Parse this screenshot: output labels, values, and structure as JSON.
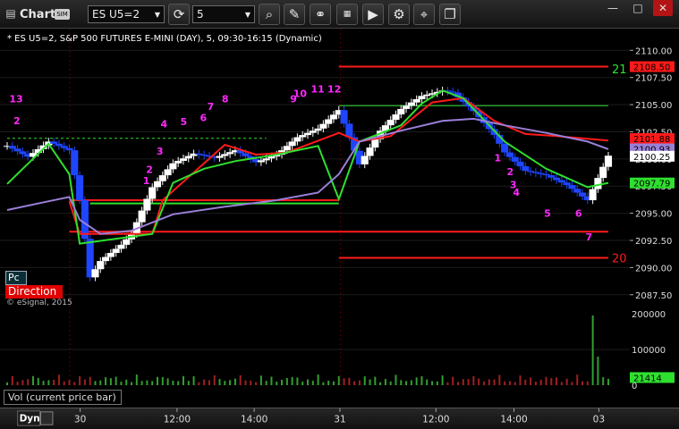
{
  "titlebar": {
    "chart_label": "Chart",
    "sim_label": "SIM",
    "symbol_value": "ES U5=2",
    "interval_value": "5",
    "icons": [
      "chart-icon",
      "refresh-icon",
      "search-icon",
      "draw-icon",
      "news-icon",
      "play-icon",
      "settings-icon",
      "pin-icon",
      "link-icon",
      "minimize-icon",
      "maximize-icon",
      "close-icon"
    ]
  },
  "header": {
    "description": "* ES U5=2, S&P 500 FUTURES E-MINI (DAY), 5, 09:30-16:15 (Dynamic)"
  },
  "badges": {
    "pc": "Pc",
    "direction": "Direction",
    "copyright": "© eSignal, 2015"
  },
  "volume_panel": {
    "label": "Vol (current price bar)"
  },
  "bottom_bar": {
    "label": "Dyn"
  },
  "colors": {
    "background": "#000000",
    "up": "#ffffff",
    "down": "#1f46ff",
    "red_level": "#ff1a1a",
    "green_level": "#2fe02f",
    "vwap": "#9a7fd8",
    "count": "#ff28ff"
  },
  "chart_data": [
    {
      "type": "line",
      "title": "",
      "ylim": [
        2086,
        2112
      ],
      "x_ticks": [
        "30",
        "12:00",
        "14:00",
        "31",
        "12:00",
        "14:00",
        "03"
      ],
      "y_ticks": [
        "2110.00",
        "2107.50",
        "2105.00",
        "2102.50",
        "2100.00",
        "2097.50",
        "2095.00",
        "2092.50",
        "2090.00",
        "2087.50"
      ],
      "price_tags": [
        {
          "value": "2108.50",
          "color": "#ff1a1a"
        },
        {
          "value": "2101.88",
          "color": "#ff1a1a"
        },
        {
          "value": "2100.93",
          "color": "#9a7fd8"
        },
        {
          "value": "2100.25",
          "color": "#ffffff"
        },
        {
          "value": "2097.79",
          "color": "#2fe02f"
        }
      ],
      "level_labels": [
        {
          "text": "21",
          "value": 2108.3,
          "color": "#2fe02f"
        },
        {
          "text": "20",
          "value": 2090.9,
          "color": "#ff1a1a"
        }
      ],
      "counts": [
        {
          "text": "13",
          "x": 0.2,
          "y": 2105.2
        },
        {
          "text": "2",
          "x": 0.6,
          "y": 2103.2
        },
        {
          "text": "1",
          "x": 13.1,
          "y": 2097.7
        },
        {
          "text": "2",
          "x": 13.4,
          "y": 2098.7
        },
        {
          "text": "3",
          "x": 14.4,
          "y": 2100.4
        },
        {
          "text": "4",
          "x": 14.8,
          "y": 2102.9
        },
        {
          "text": "5",
          "x": 16.7,
          "y": 2103.1
        },
        {
          "text": "6",
          "x": 18.6,
          "y": 2103.5
        },
        {
          "text": "7",
          "x": 19.3,
          "y": 2104.5
        },
        {
          "text": "8",
          "x": 20.7,
          "y": 2105.2
        },
        {
          "text": "9",
          "x": 27.3,
          "y": 2105.2
        },
        {
          "text": "10",
          "x": 27.6,
          "y": 2105.7
        },
        {
          "text": "11",
          "x": 29.3,
          "y": 2106.1
        },
        {
          "text": "12",
          "x": 30.9,
          "y": 2106.1
        },
        {
          "text": "1",
          "x": 47.0,
          "y": 2099.8
        },
        {
          "text": "2",
          "x": 48.2,
          "y": 2098.5
        },
        {
          "text": "3",
          "x": 48.5,
          "y": 2097.3
        },
        {
          "text": "4",
          "x": 48.8,
          "y": 2096.6
        },
        {
          "text": "5",
          "x": 51.8,
          "y": 2094.7
        },
        {
          "text": "6",
          "x": 54.8,
          "y": 2094.7
        },
        {
          "text": "7",
          "x": 55.8,
          "y": 2092.5
        }
      ],
      "series": [
        {
          "points": [
            [
              0,
              2101.2
            ],
            [
              2,
              2100.2
            ],
            [
              4,
              2101.6
            ],
            [
              6,
              2100.8
            ],
            [
              7,
              2096.2
            ],
            [
              8,
              2089.1
            ],
            [
              9,
              2090.6
            ],
            [
              11,
              2092.1
            ],
            [
              12,
              2093.1
            ],
            [
              14,
              2097.4
            ],
            [
              16,
              2099.6
            ],
            [
              18,
              2100.5
            ],
            [
              20,
              2100.1
            ],
            [
              22,
              2100.8
            ],
            [
              24,
              2099.7
            ],
            [
              26,
              2100.4
            ],
            [
              28,
              2102.0
            ],
            [
              30,
              2102.8
            ],
            [
              32,
              2104.5
            ],
            [
              34,
              2099.5
            ],
            [
              36,
              2102.6
            ],
            [
              38,
              2104.6
            ],
            [
              40,
              2105.8
            ],
            [
              42,
              2106.3
            ],
            [
              43,
              2106.1
            ],
            [
              45,
              2104.4
            ],
            [
              47,
              2102.2
            ],
            [
              48,
              2100.6
            ],
            [
              50,
              2098.9
            ],
            [
              52,
              2098.5
            ],
            [
              54,
              2097.6
            ],
            [
              56,
              2096.2
            ],
            [
              58,
              2100.3
            ]
          ]
        },
        {
          "color": "#ff1a1a",
          "points": [
            [
              6,
              2096.1
            ],
            [
              7,
              2093.1
            ],
            [
              14,
              2093.1
            ],
            [
              15,
              2096.2
            ],
            [
              21,
              2101.3
            ],
            [
              24,
              2100.4
            ],
            [
              27,
              2100.6
            ],
            [
              32,
              2102.4
            ],
            [
              34,
              2101.6
            ],
            [
              37,
              2102.1
            ],
            [
              41,
              2105.2
            ],
            [
              44,
              2105.6
            ],
            [
              47,
              2103.5
            ],
            [
              50,
              2102.3
            ],
            [
              53,
              2102.1
            ],
            [
              58,
              2101.7
            ]
          ]
        },
        {
          "color": "#2fe02f",
          "points": [
            [
              0,
              2097.7
            ],
            [
              4,
              2101.4
            ],
            [
              6,
              2098.6
            ],
            [
              7,
              2092.2
            ],
            [
              14,
              2093.1
            ],
            [
              16,
              2097.8
            ],
            [
              19,
              2099.1
            ],
            [
              22,
              2099.8
            ],
            [
              26,
              2100.4
            ],
            [
              30,
              2101.2
            ],
            [
              32,
              2096.3
            ],
            [
              34,
              2101.6
            ],
            [
              38,
              2103.1
            ],
            [
              40,
              2105.1
            ],
            [
              42,
              2106.3
            ],
            [
              44,
              2105.6
            ],
            [
              48,
              2101.6
            ],
            [
              52,
              2099.1
            ],
            [
              56,
              2097.4
            ],
            [
              58,
              2097.8
            ]
          ]
        },
        {
          "color": "#9a7fd8",
          "points": [
            [
              0,
              2095.3
            ],
            [
              4,
              2096.1
            ],
            [
              6,
              2096.5
            ],
            [
              7,
              2094.4
            ],
            [
              9,
              2093.1
            ],
            [
              12,
              2093.4
            ],
            [
              16,
              2094.9
            ],
            [
              21,
              2095.6
            ],
            [
              26,
              2096.2
            ],
            [
              30,
              2096.9
            ],
            [
              32,
              2098.6
            ],
            [
              34,
              2101.6
            ],
            [
              38,
              2102.6
            ],
            [
              42,
              2103.5
            ],
            [
              45,
              2103.7
            ],
            [
              48,
              2103.1
            ],
            [
              52,
              2102.4
            ],
            [
              56,
              2101.6
            ],
            [
              58,
              2100.9
            ]
          ]
        }
      ]
    },
    {
      "type": "bar",
      "title": "",
      "ylim": [
        0,
        200000
      ],
      "y_ticks": [
        "200000",
        "100000",
        "0"
      ],
      "last_value": "21414"
    }
  ]
}
